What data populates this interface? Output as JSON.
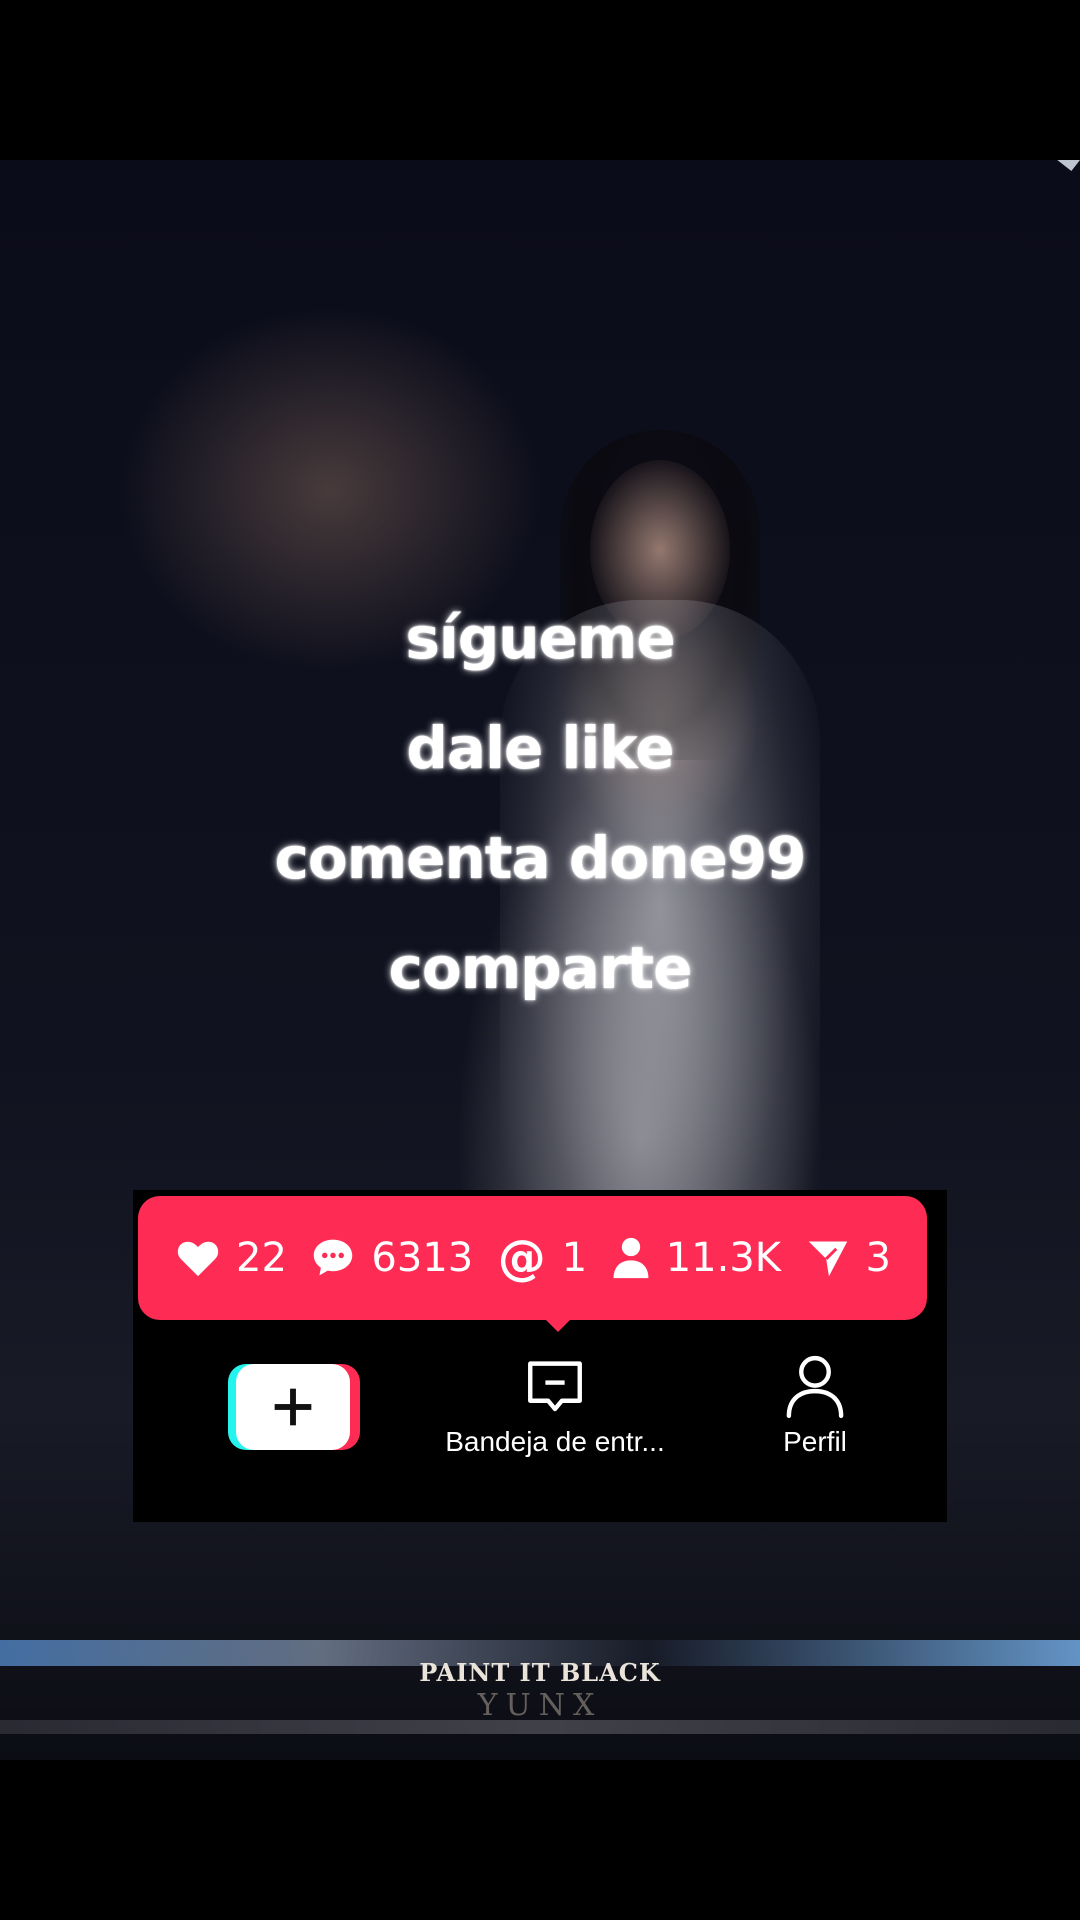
{
  "overlay": {
    "line1": "sígueme",
    "line2": "dale like",
    "line3": "comenta done99",
    "line4": "comparte"
  },
  "watermark": {
    "title": "PAINT IT BLACK",
    "sub": "YUNX"
  },
  "stats": {
    "likes": "22",
    "comments": "6313",
    "mentions": "1",
    "followers": "11.3K",
    "shares": "3"
  },
  "nav": {
    "create_icon": "plus-icon",
    "inbox_label": "Bandeja de entr...",
    "profile_label": "Perfil"
  },
  "colors": {
    "accent": "#fe2c55",
    "cyan": "#25f4ee",
    "panel": "#000000"
  }
}
